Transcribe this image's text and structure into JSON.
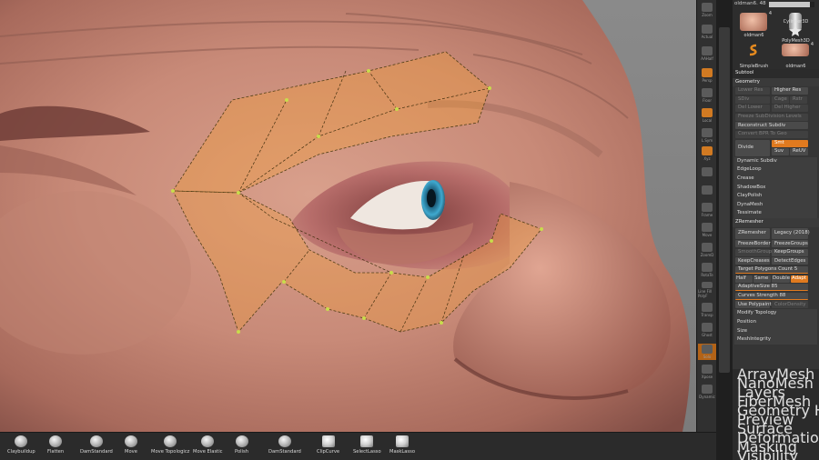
{
  "subtool_header": {
    "name": "oldman6",
    "count": "48"
  },
  "subtool_thumbs": [
    {
      "name": "oldman6",
      "count": "4"
    },
    {
      "name": "Cylinder3D",
      "count": ""
    },
    {
      "name": "PolyMesh3D",
      "count": ""
    },
    {
      "name": "SimpleBrush",
      "count": ""
    },
    {
      "name": "oldman6",
      "count": "4"
    }
  ],
  "right_shelf": [
    {
      "label": "Zoom",
      "icon": "zoom-icon"
    },
    {
      "label": "Actual",
      "icon": "actual-icon"
    },
    {
      "label": "AAHalf",
      "icon": "aahalf-icon"
    },
    {
      "label": "Persp",
      "icon": "persp-icon",
      "active": true
    },
    {
      "label": "Floor",
      "icon": "floor-icon"
    },
    {
      "label": "Local",
      "icon": "local-icon",
      "active": true
    },
    {
      "label": "L.Sym",
      "icon": "lsym-icon"
    },
    {
      "label": "Xyz",
      "icon": "xyz-icon",
      "active": true
    },
    {
      "label": "",
      "icon": "rotate-y-icon"
    },
    {
      "label": "",
      "icon": "rotate-z-icon"
    },
    {
      "label": "Frame",
      "icon": "frame-icon"
    },
    {
      "label": "Move",
      "icon": "move-icon"
    },
    {
      "label": "ZoomD",
      "icon": "zoom3d-icon"
    },
    {
      "label": "RotaTe",
      "icon": "rotate-icon"
    },
    {
      "label": "Line Fill PolyF",
      "icon": "polyframe-icon"
    },
    {
      "label": "Transp",
      "icon": "transp-icon"
    },
    {
      "label": "Ghost",
      "icon": "ghost-icon"
    },
    {
      "label": "Solo",
      "icon": "solo-icon",
      "orangefull": true
    },
    {
      "label": "Xpose",
      "icon": "xpose-icon"
    },
    {
      "label": "Dynamic",
      "icon": "dynamic-icon"
    }
  ],
  "menu": {
    "subtool": "Subtool",
    "geometry": "Geometry",
    "lower_res": "Lower Res",
    "higher_res": "Higher Res",
    "sdiv": "SDiv",
    "cage": "Cage",
    "rstr": "Rstr",
    "del_lower": "Del Lower",
    "del_higher": "Del Higher",
    "freeze_subdivision": "Freeze SubDivision Levels",
    "reconstruct_subdiv": "Reconstruct Subdiv",
    "convert_bpr": "Convert BPR To Geo",
    "divide": "Divide",
    "smt": "Smt",
    "suv": "Suv",
    "reuv": "ReUV",
    "items": [
      "Dynamic Subdiv",
      "EdgeLoop",
      "Crease",
      "ShadowBox",
      "ClayPolish",
      "DynaMesh",
      "Tessimate"
    ],
    "zremesher_header": "ZRemesher",
    "zremesher_btn": "ZRemesher",
    "legacy": "Legacy (2018)",
    "freeze_border": "FreezeBorder",
    "freeze_groups": "FreezeGroups",
    "smooth_groups": "SmoothGroups",
    "keep_groups": "KeepGroups",
    "keep_creases": "KeepCreases",
    "detect_edges": "DetectEdges",
    "target_polygons": "Target Polygons Count 5",
    "half": "Half",
    "same": "Same",
    "double": "Double",
    "adapt": "Adapt",
    "adaptive_size": "AdaptiveSize 85",
    "curves_strength": "Curves Strength 88",
    "use_polypaint": "Use Polypaint",
    "color_density": "ColorDensity",
    "tail": [
      "Modify Topology",
      "Position",
      "Size",
      "MeshIntegrity"
    ]
  },
  "lower_menu": [
    "ArrayMesh",
    "NanoMesh",
    "Layers",
    "FiberMesh",
    "Geometry HD",
    "Preview",
    "Surface",
    "Deformation",
    "Masking",
    "Visibility"
  ],
  "brushes": [
    "Claybuildup",
    "Flatten",
    "DamStandard",
    "Move",
    "Move Topologicz",
    "Move Elastic",
    "Polish",
    "DamStandard",
    "ClipCurve",
    "SelectLasso",
    "MaskLasso"
  ]
}
